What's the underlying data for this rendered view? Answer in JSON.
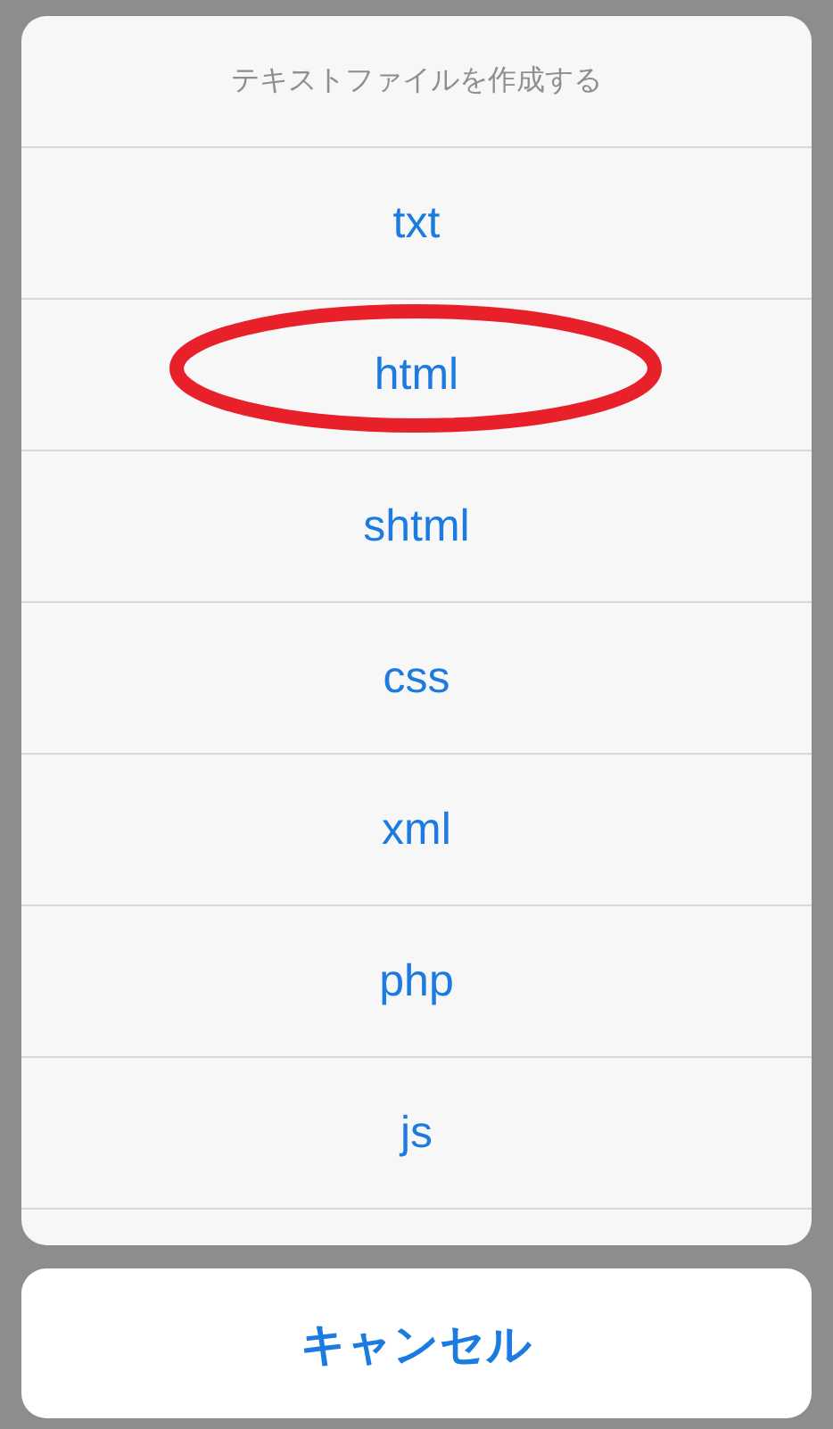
{
  "action_sheet": {
    "title": "テキストファイルを作成する",
    "options": [
      {
        "label": "txt",
        "circled": false
      },
      {
        "label": "html",
        "circled": true
      },
      {
        "label": "shtml",
        "circled": false
      },
      {
        "label": "css",
        "circled": false
      },
      {
        "label": "xml",
        "circled": false
      },
      {
        "label": "php",
        "circled": false
      },
      {
        "label": "js",
        "circled": false
      }
    ],
    "cancel": "キャンセル"
  }
}
